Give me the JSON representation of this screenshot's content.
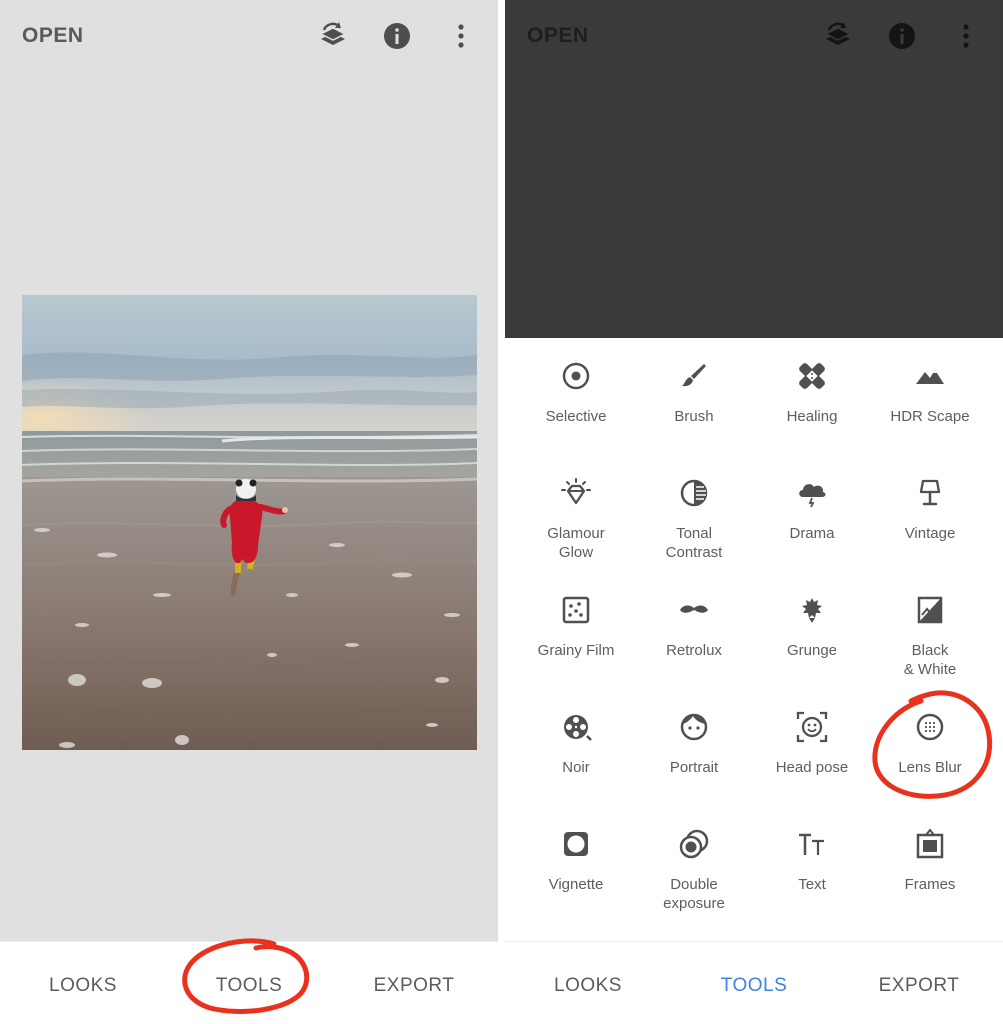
{
  "left": {
    "open_label": "OPEN",
    "nav": {
      "looks": "LOOKS",
      "tools": "TOOLS",
      "export": "EXPORT"
    }
  },
  "right": {
    "open_label": "OPEN",
    "tools": [
      {
        "label": "Selective",
        "icon": "selective-icon"
      },
      {
        "label": "Brush",
        "icon": "brush-icon"
      },
      {
        "label": "Healing",
        "icon": "healing-icon"
      },
      {
        "label": "HDR Scape",
        "icon": "hdr-scape-icon"
      },
      {
        "label": "Glamour\nGlow",
        "icon": "glamour-glow-icon"
      },
      {
        "label": "Tonal\nContrast",
        "icon": "tonal-contrast-icon"
      },
      {
        "label": "Drama",
        "icon": "drama-icon"
      },
      {
        "label": "Vintage",
        "icon": "vintage-icon"
      },
      {
        "label": "Grainy Film",
        "icon": "grainy-film-icon"
      },
      {
        "label": "Retrolux",
        "icon": "retrolux-icon"
      },
      {
        "label": "Grunge",
        "icon": "grunge-icon"
      },
      {
        "label": "Black\n& White",
        "icon": "black-white-icon"
      },
      {
        "label": "Noir",
        "icon": "noir-icon"
      },
      {
        "label": "Portrait",
        "icon": "portrait-icon"
      },
      {
        "label": "Head pose",
        "icon": "head-pose-icon"
      },
      {
        "label": "Lens Blur",
        "icon": "lens-blur-icon"
      },
      {
        "label": "Vignette",
        "icon": "vignette-icon"
      },
      {
        "label": "Double\nexposure",
        "icon": "double-exposure-icon"
      },
      {
        "label": "Text",
        "icon": "text-icon"
      },
      {
        "label": "Frames",
        "icon": "frames-icon"
      }
    ],
    "nav": {
      "looks": "LOOKS",
      "tools": "TOOLS",
      "export": "EXPORT"
    }
  },
  "colors": {
    "accent": "#3d82e8",
    "annotation": "#e8321e",
    "icon": "#505050"
  }
}
